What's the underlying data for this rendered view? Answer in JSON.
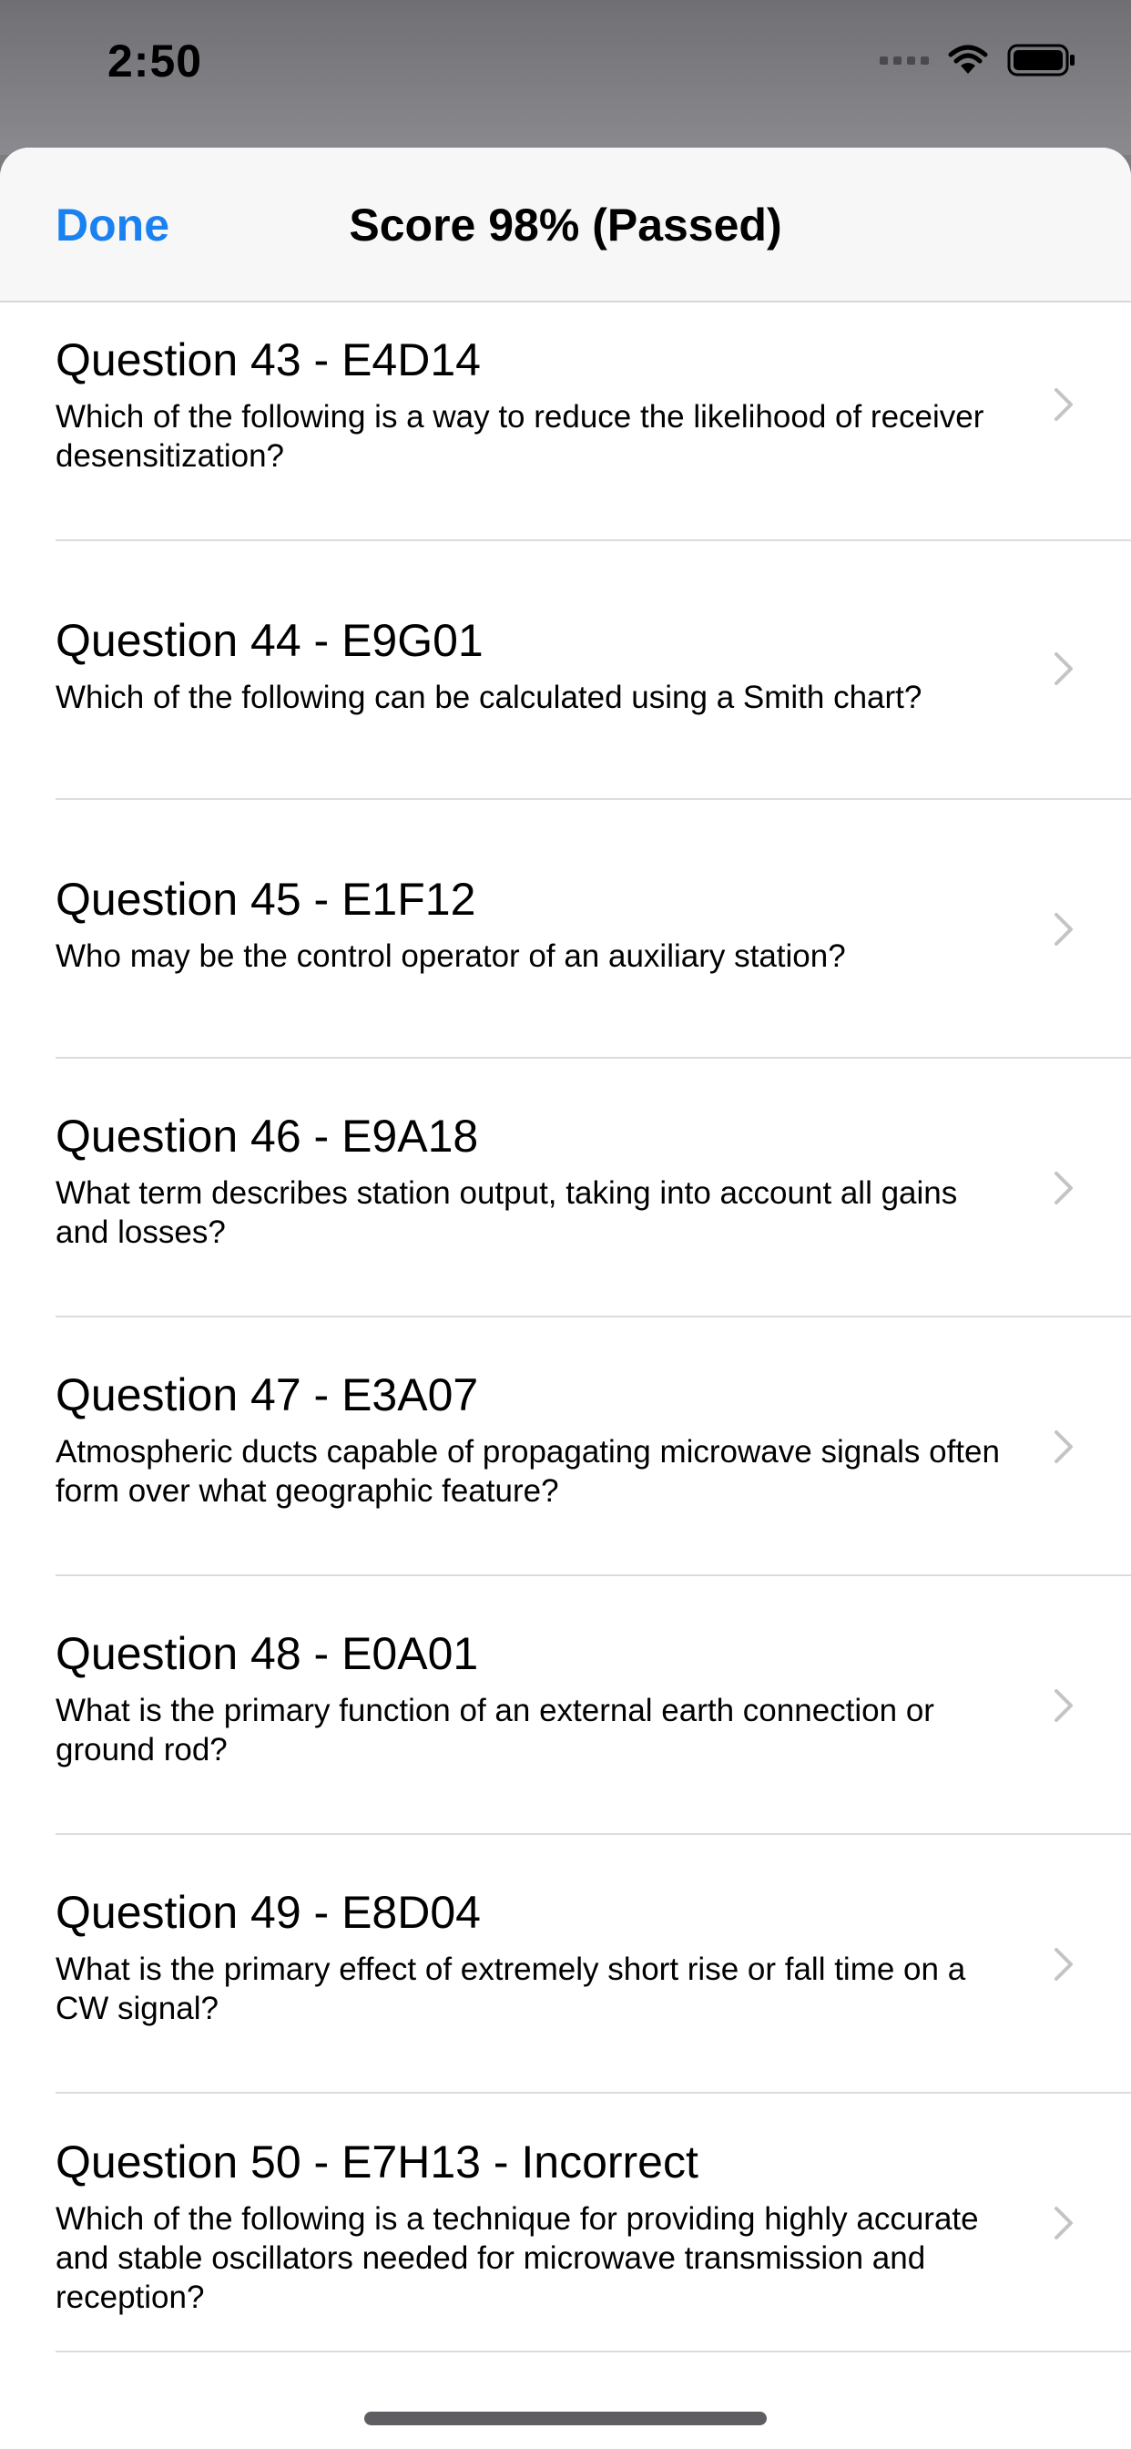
{
  "status_bar": {
    "time": "2:50"
  },
  "navbar": {
    "done_label": "Done",
    "title": "Score 98% (Passed)"
  },
  "colors": {
    "accent": "#1a82f0"
  },
  "questions": [
    {
      "title": "Question 43 - E4D14",
      "text": "Which of the following is a way to reduce the likelihood of receiver desensitization?"
    },
    {
      "title": "Question 44 - E9G01",
      "text": "Which of the following can be calculated using a Smith chart?"
    },
    {
      "title": "Question 45 - E1F12",
      "text": "Who may be the control operator of an auxiliary station?"
    },
    {
      "title": "Question 46 - E9A18",
      "text": "What term describes station output, taking into account all gains and losses?"
    },
    {
      "title": "Question 47 - E3A07",
      "text": "Atmospheric ducts capable of propagating microwave signals often form over what geographic feature?"
    },
    {
      "title": "Question 48 - E0A01",
      "text": "What is the primary function of an external earth connection or ground rod?"
    },
    {
      "title": "Question 49 - E8D04",
      "text": "What is the primary effect of extremely short rise or fall time on a CW signal?"
    },
    {
      "title": "Question 50 - E7H13 - Incorrect",
      "text": "Which of the following is a technique for providing highly accurate and stable oscillators needed for microwave transmission and reception?"
    }
  ]
}
